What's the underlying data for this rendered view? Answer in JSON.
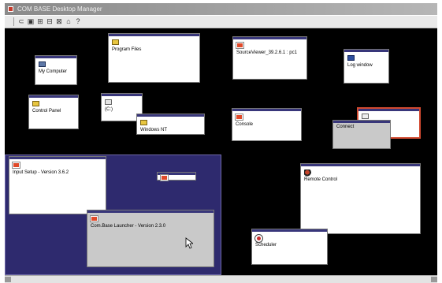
{
  "app": {
    "title": "COM BASE Desktop Manager"
  },
  "toolbar": {
    "buttons": [
      {
        "name": "open-icon",
        "glyph": "⊂"
      },
      {
        "name": "save-icon",
        "glyph": "▣"
      },
      {
        "name": "tool1-icon",
        "glyph": "⊞"
      },
      {
        "name": "tool2-icon",
        "glyph": "⊟"
      },
      {
        "name": "tool3-icon",
        "glyph": "⊠"
      },
      {
        "name": "home-icon",
        "glyph": "⌂"
      },
      {
        "name": "help-icon",
        "glyph": "?"
      }
    ]
  },
  "desktop": {
    "top_left": {
      "windows": [
        {
          "label": "My Computer",
          "icon": "computer-icon"
        },
        {
          "label": "Program Files",
          "icon": "folder-icon"
        },
        {
          "label": "Control Panel",
          "icon": "folder-icon"
        },
        {
          "label": "(C:)",
          "icon": "drive-icon"
        },
        {
          "label": "Windows NT",
          "icon": "folder-icon"
        }
      ]
    },
    "top_right": {
      "windows": [
        {
          "label": "SourceViewer_39.2.6.1 : pc1",
          "icon": "app-icon"
        },
        {
          "label": "Log window",
          "icon": "log-icon"
        },
        {
          "label": "Console",
          "icon": "app-icon"
        },
        {
          "label": "Connect",
          "icon": "connect-icon"
        }
      ]
    },
    "bottom_left": {
      "windows": [
        {
          "label": "Input Setup - Version 3.6.2",
          "icon": "app-icon"
        },
        {
          "label": "",
          "icon": "app-icon"
        },
        {
          "label": "Com.Base Launcher - Version 2.3.0",
          "icon": "app-icon"
        }
      ]
    },
    "bottom_right": {
      "windows": [
        {
          "label": "Remote Control",
          "icon": "remote-icon"
        },
        {
          "label": "Scheduler",
          "icon": "scheduler-icon"
        }
      ]
    }
  },
  "colors": {
    "window_title_strip": "#38367a",
    "active_quadrant": "#2e2a6e",
    "selected_border": "#d24a30"
  }
}
